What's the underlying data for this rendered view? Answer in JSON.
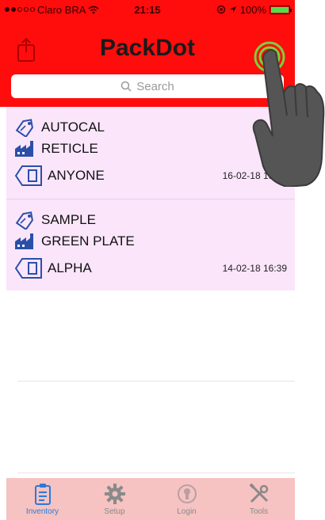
{
  "status_bar": {
    "carrier": "Claro BRA",
    "time": "21:15",
    "battery": "100%",
    "battery_level": 1.0
  },
  "header": {
    "title": "PackDot",
    "left_icon": "export-icon",
    "right_icon": "scan-target-icon"
  },
  "search": {
    "placeholder": "Search"
  },
  "items": [
    {
      "name": "AUTOCAL",
      "location": "RETICLE",
      "user": "ANYONE",
      "date": "16-02-18 19:28"
    },
    {
      "name": "SAMPLE",
      "location": "GREEN PLATE",
      "user": "ALPHA",
      "date": "14-02-18 16:39"
    }
  ],
  "tabs": [
    {
      "label": "Inventory",
      "icon": "clipboard-icon",
      "active": true
    },
    {
      "label": "Setup",
      "icon": "gear-icon",
      "active": false
    },
    {
      "label": "Login",
      "icon": "login-icon",
      "active": false
    },
    {
      "label": "Tools",
      "icon": "tools-icon",
      "active": false
    }
  ],
  "colors": {
    "header": "#ff0d0d",
    "list_bg": "#fbe5fb",
    "tabbar_bg": "#f6c2c2",
    "active_tab": "#2b7ad9",
    "scan_button": "#7ad13a"
  }
}
